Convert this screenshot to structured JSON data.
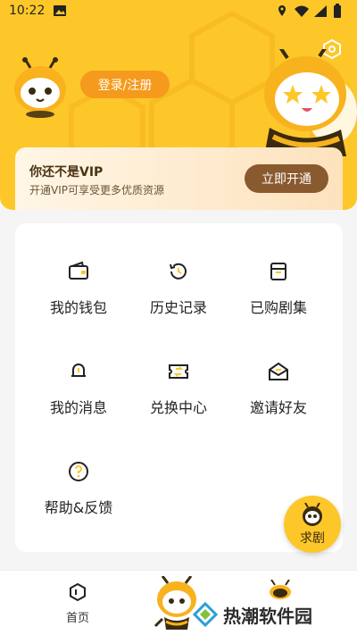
{
  "status_bar": {
    "time": "10:22",
    "left_icon": "gallery-icon",
    "right_icons": [
      "location-icon",
      "wifi-icon",
      "signal-icon",
      "battery-icon"
    ]
  },
  "header": {
    "settings_icon": "settings-hexagon-icon",
    "login_label": "登录/注册",
    "accent_color": "#fdc72a",
    "login_color": "#f59a1c"
  },
  "vip": {
    "title": "你还不是VIP",
    "subtitle": "开通VIP可享受更多优质资源",
    "button_label": "立即开通",
    "button_color": "#8a5a2f"
  },
  "menu": {
    "items": [
      {
        "label": "我的钱包",
        "icon": "wallet-icon"
      },
      {
        "label": "历史记录",
        "icon": "history-icon"
      },
      {
        "label": "已购剧集",
        "icon": "purchased-box-icon"
      },
      {
        "label": "我的消息",
        "icon": "bell-icon"
      },
      {
        "label": "兑换中心",
        "icon": "exchange-ticket-icon"
      },
      {
        "label": "邀请好友",
        "icon": "invite-envelope-icon"
      },
      {
        "label": "帮助&反馈",
        "icon": "help-question-icon"
      }
    ]
  },
  "float_button": {
    "label": "求剧",
    "icon": "bee-face-icon"
  },
  "bottom_nav": {
    "items": [
      {
        "label": "首页",
        "icon": "home-hexagon-icon"
      }
    ]
  },
  "watermark": {
    "text": "热潮软件园"
  }
}
